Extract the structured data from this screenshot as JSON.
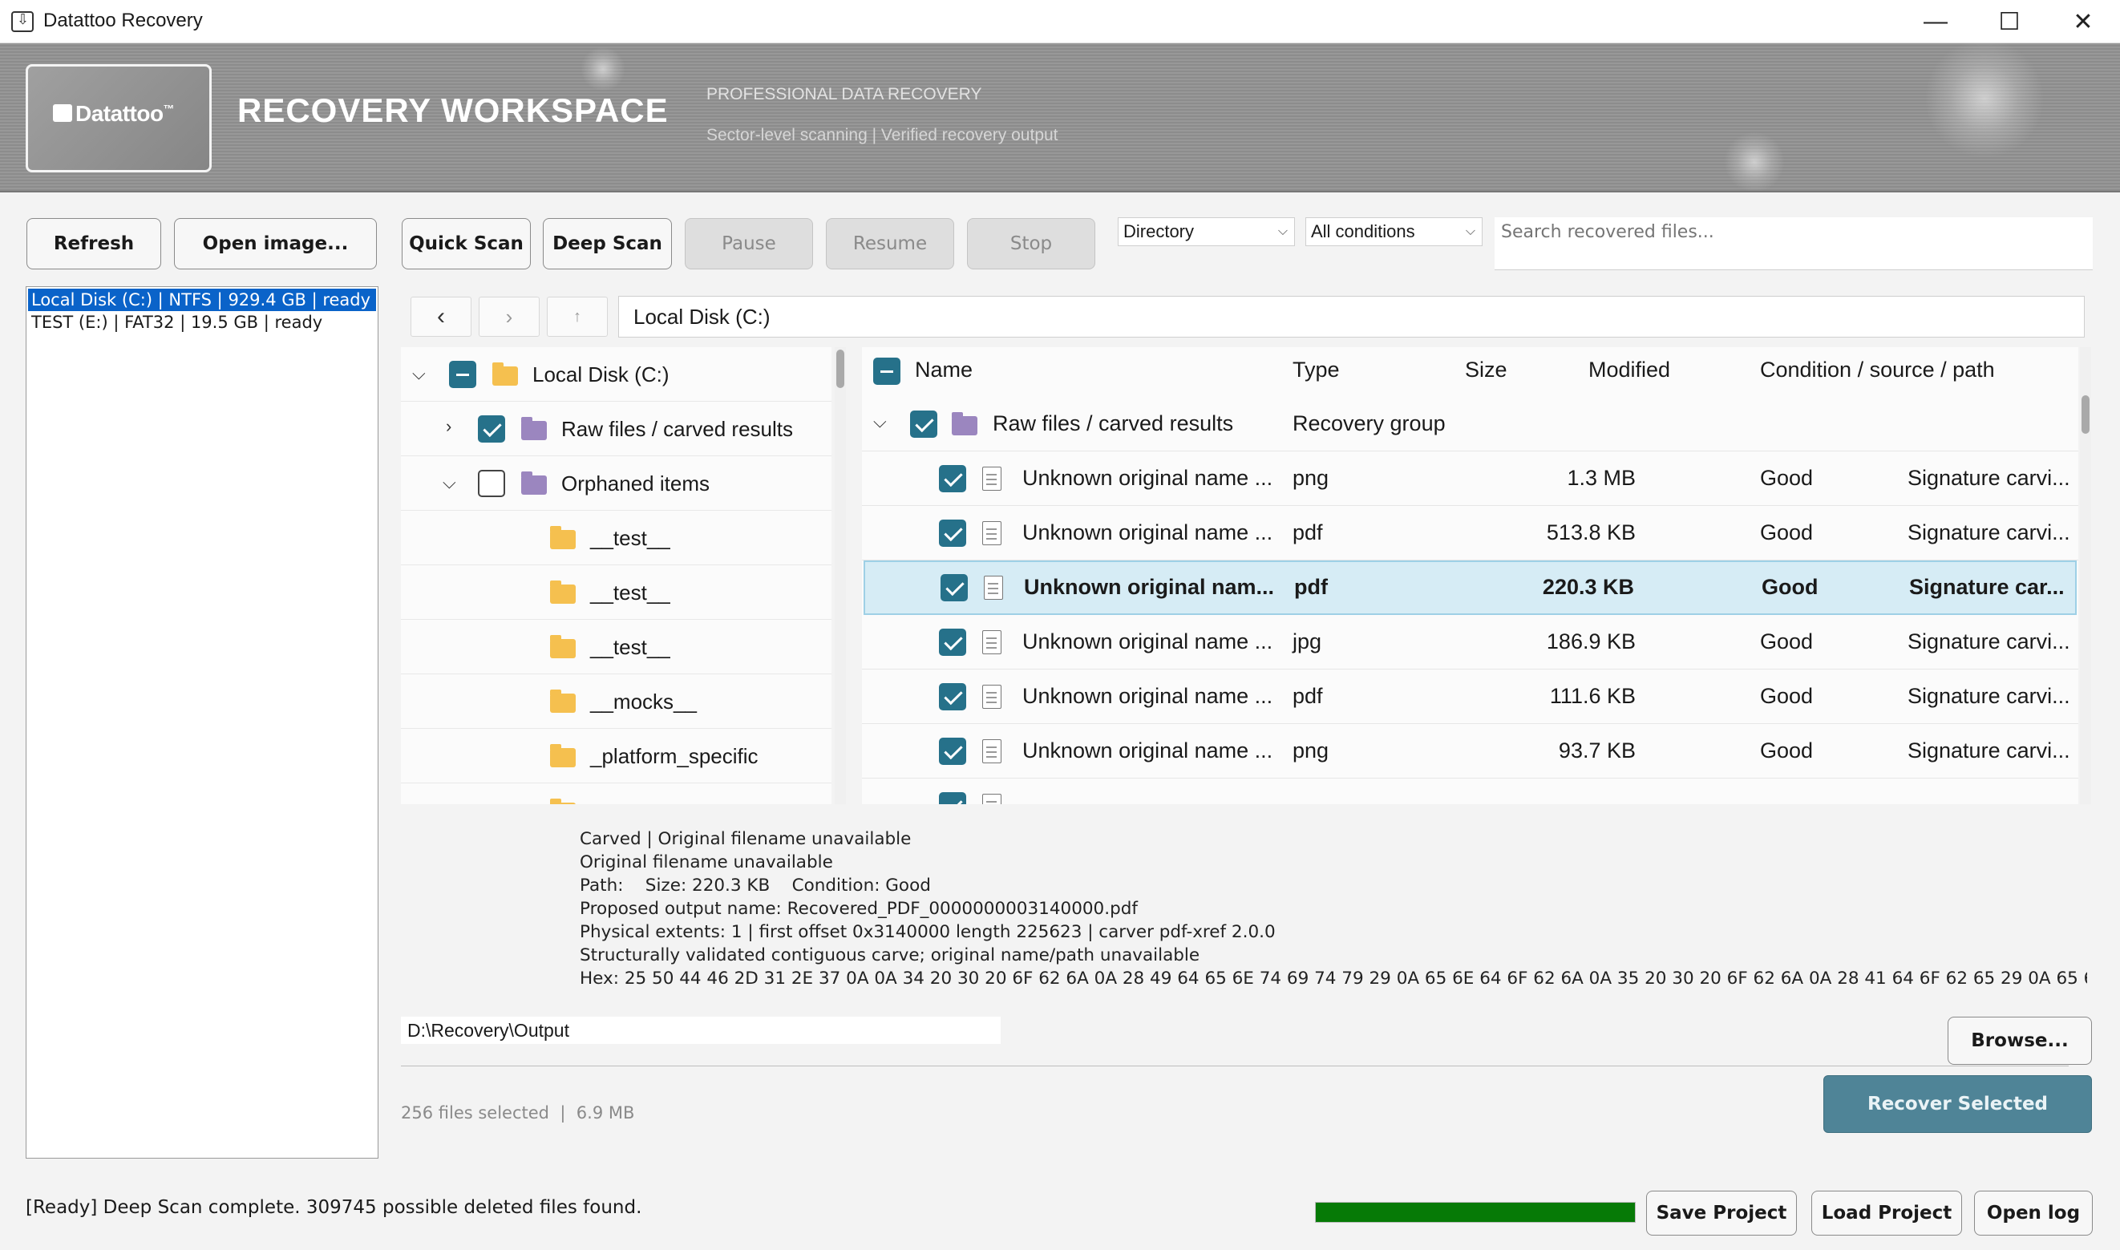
{
  "window": {
    "title": "Datattoo Recovery",
    "controls": {
      "minimize": "—",
      "maximize": "☐",
      "close": "✕"
    }
  },
  "banner": {
    "logo": "Datattoo",
    "logo_tm": "™",
    "title": "RECOVERY WORKSPACE",
    "subtitle": "PROFESSIONAL DATA RECOVERY",
    "tagline": "Sector-level scanning  |  Verified recovery output"
  },
  "toolbar": {
    "refresh": "Refresh",
    "open_image": "Open image...",
    "quick_scan": "Quick Scan",
    "deep_scan": "Deep Scan",
    "pause": "Pause",
    "resume": "Resume",
    "stop": "Stop",
    "view_mode": "Directory",
    "condition_filter": "All conditions",
    "search_placeholder": "Search recovered files..."
  },
  "disks": [
    {
      "label": "Local Disk (C:)  |  NTFS  |  929.4 GB  |  ready",
      "selected": true
    },
    {
      "label": "TEST (E:)  |  FAT32  |  19.5 GB  |  ready",
      "selected": false
    }
  ],
  "nav": {
    "back": "‹",
    "forward": "›",
    "up": "↑",
    "path": "Local Disk (C:)"
  },
  "tree": [
    {
      "label": "Local Disk (C:)"
    },
    {
      "label": "Raw files / carved results"
    },
    {
      "label": "Orphaned items"
    },
    {
      "label": "__test__"
    },
    {
      "label": "__test__"
    },
    {
      "label": "__test__"
    },
    {
      "label": "__mocks__"
    },
    {
      "label": "_platform_specific"
    }
  ],
  "table": {
    "headers": {
      "name": "Name",
      "type": "Type",
      "size": "Size",
      "modified": "Modified",
      "condition": "Condition / source / path"
    },
    "group": {
      "name": "Raw files / carved results",
      "type": "Recovery group"
    },
    "rows": [
      {
        "name": "Unknown original name ...",
        "type": "png",
        "size": "1.3 MB",
        "condition": "Good",
        "source": "Signature carvi..."
      },
      {
        "name": "Unknown original name ...",
        "type": "pdf",
        "size": "513.8 KB",
        "condition": "Good",
        "source": "Signature carvi..."
      },
      {
        "name": "Unknown original nam...",
        "type": "pdf",
        "size": "220.3 KB",
        "condition": "Good",
        "source": "Signature car..."
      },
      {
        "name": "Unknown original name ...",
        "type": "jpg",
        "size": "186.9 KB",
        "condition": "Good",
        "source": "Signature carvi..."
      },
      {
        "name": "Unknown original name ...",
        "type": "pdf",
        "size": "111.6 KB",
        "condition": "Good",
        "source": "Signature carvi..."
      },
      {
        "name": "Unknown original name ...",
        "type": "png",
        "size": "93.7 KB",
        "condition": "Good",
        "source": "Signature carvi..."
      }
    ]
  },
  "details": [
    "Carved | Original filename unavailable",
    "Original filename unavailable",
    "Path:    Size: 220.3 KB    Condition: Good",
    "Proposed output name: Recovered_PDF_0000000003140000.pdf",
    "Physical extents: 1 | first offset 0x3140000 length 225623 | carver pdf-xref 2.0.0",
    "Structurally validated contiguous carve; original name/path unavailable",
    "Hex: 25 50 44 46 2D 31 2E 37 0A 0A 34 20 30 20 6F 62 6A 0A 28 49 64 65 6E 74 69 74 79 29 0A 65 6E 64 6F 62 6A 0A 35 20 30 20 6F 62 6A 0A 28 41 64 6F 62 65 29 0A 65 6E 64 6F"
  ],
  "output": {
    "path": "D:\\Recovery\\Output",
    "browse": "Browse...",
    "summary": "256 files selected  |  6.9 MB",
    "recover": "Recover Selected"
  },
  "status": {
    "text": "[Ready] Deep Scan complete. 309745 possible deleted files found.",
    "progress": 1.0,
    "save": "Save Project",
    "load": "Load Project",
    "log": "Open log"
  },
  "colors": {
    "accent": "#26718a",
    "selection": "#0a63c9",
    "progress": "#067a06",
    "recover": "#4f8497"
  }
}
